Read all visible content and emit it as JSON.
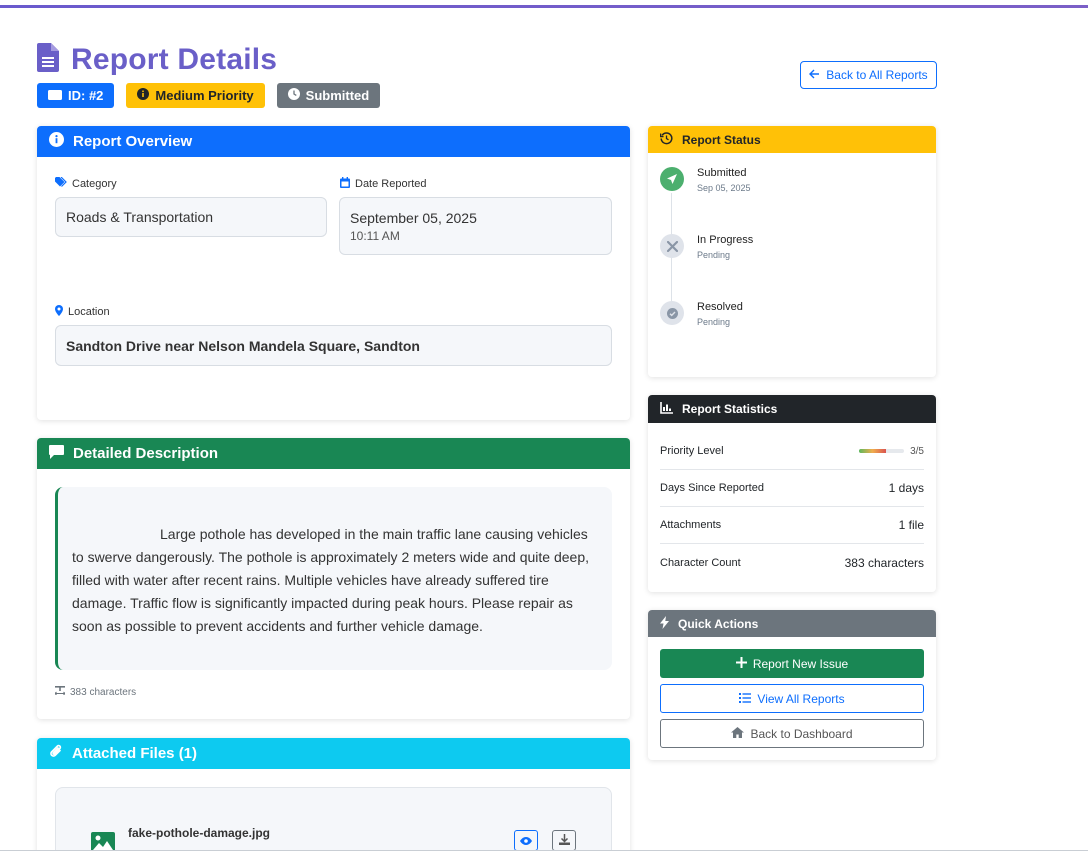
{
  "header": {
    "title": "Report Details",
    "badges": {
      "id": "ID: #2",
      "priority": "Medium Priority",
      "status": "Submitted"
    },
    "back_button": "Back to All Reports"
  },
  "overview": {
    "title": "Report Overview",
    "category_label": "Category",
    "category_value": "Roads & Transportation",
    "date_label": "Date Reported",
    "date_value": "September 05, 2025",
    "time_value": "10:11 AM",
    "location_label": "Location",
    "location_value": "Sandton Drive near Nelson Mandela Square, Sandton"
  },
  "description": {
    "title": "Detailed Description",
    "text": "Large pothole has developed in the main traffic lane causing vehicles to swerve dangerously. The pothole is approximately 2 meters wide and quite deep, filled with water after recent rains. Multiple vehicles have already suffered tire damage. Traffic flow is significantly impacted during peak hours. Please repair as soon as possible to prevent accidents and further vehicle damage.",
    "char_count": "383 characters"
  },
  "attachments": {
    "title": "Attached Files (1)",
    "files": [
      {
        "name": "fake-pothole-damage.jpg"
      }
    ]
  },
  "status": {
    "title": "Report Status",
    "steps": [
      {
        "title": "Submitted",
        "sub": "Sep 05, 2025",
        "color": "#4caf6e"
      },
      {
        "title": "In Progress",
        "sub": "Pending",
        "color": "#dfe3ea"
      },
      {
        "title": "Resolved",
        "sub": "Pending",
        "color": "#dfe3ea"
      }
    ]
  },
  "statistics": {
    "title": "Report Statistics",
    "priority_label": "Priority Level",
    "priority_value": "3/5",
    "priority_fraction": 0.6,
    "days_label": "Days Since Reported",
    "days_value": "1 days",
    "attachments_label": "Attachments",
    "attachments_value": "1 file",
    "chars_label": "Character Count",
    "chars_value": "383 characters"
  },
  "quick_actions": {
    "title": "Quick Actions",
    "report_new": "Report New Issue",
    "view_all": "View All Reports",
    "back_dashboard": "Back to Dashboard"
  },
  "colors": {
    "primary": "#0d6efd",
    "success": "#198754",
    "warning": "#ffc107",
    "info": "#0dcaf0",
    "dark": "#212529",
    "secondary": "#6c757d",
    "title": "#6a5fc8"
  }
}
